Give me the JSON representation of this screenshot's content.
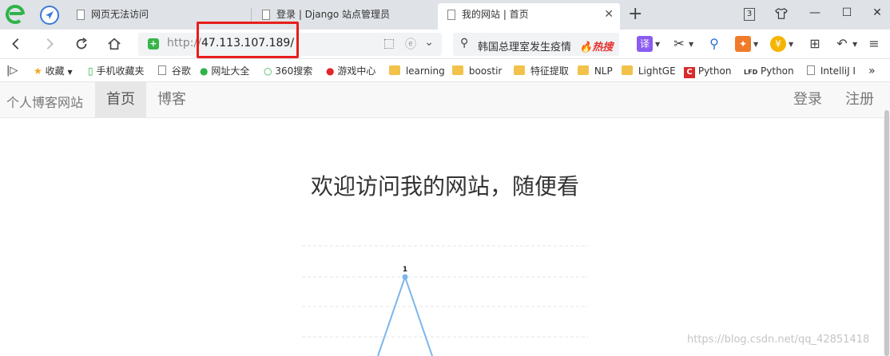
{
  "browser": {
    "tabs": [
      {
        "title": "网页无法访问",
        "active": false
      },
      {
        "title": "登录 | Django 站点管理员",
        "active": false
      },
      {
        "title": "我的网站 | 首页",
        "active": true
      }
    ],
    "new_tab": "+",
    "window_controls": {
      "badge": "3"
    }
  },
  "address_bar": {
    "scheme": "http://",
    "host": "47.113.107.189/",
    "highlight_color": "#e81d1d"
  },
  "search_bar": {
    "query": "韩国总理室发生疫情",
    "hot_label": "热搜"
  },
  "extensions": {
    "translate": "译"
  },
  "bookmarks": [
    {
      "label": "收藏",
      "icon": "star-icon"
    },
    {
      "label": "手机收藏夹",
      "icon": "phone-icon"
    },
    {
      "label": "谷歌",
      "icon": "doc-icon"
    },
    {
      "label": "网址大全",
      "icon": "nav-icon"
    },
    {
      "label": "360搜索",
      "icon": "search360-icon"
    },
    {
      "label": "游戏中心",
      "icon": "game-icon"
    },
    {
      "label": "learning",
      "icon": "folder-icon"
    },
    {
      "label": "boostir",
      "icon": "folder-icon"
    },
    {
      "label": "特征提取",
      "icon": "folder-icon"
    },
    {
      "label": "NLP",
      "icon": "folder-icon"
    },
    {
      "label": "LightGE",
      "icon": "folder-icon"
    },
    {
      "label": "Python",
      "icon": "c-icon"
    },
    {
      "label": "Python",
      "icon": "lfd-icon",
      "prefix": "LFD"
    },
    {
      "label": "IntelliJ I",
      "icon": "doc-icon"
    }
  ],
  "bookmarks_more": "»",
  "site": {
    "brand": "个人博客网站",
    "nav": [
      {
        "label": "首页",
        "active": true
      },
      {
        "label": "博客",
        "active": false
      }
    ],
    "auth": {
      "login": "登录",
      "register": "注册"
    },
    "heading": "欢迎访问我的网站，随便看"
  },
  "chart_data": {
    "type": "line",
    "series": [
      {
        "values": [
          1
        ]
      }
    ],
    "point_label": "1",
    "line_color": "#7cb5ec"
  },
  "watermark": "https://blog.csdn.net/qq_42851418"
}
